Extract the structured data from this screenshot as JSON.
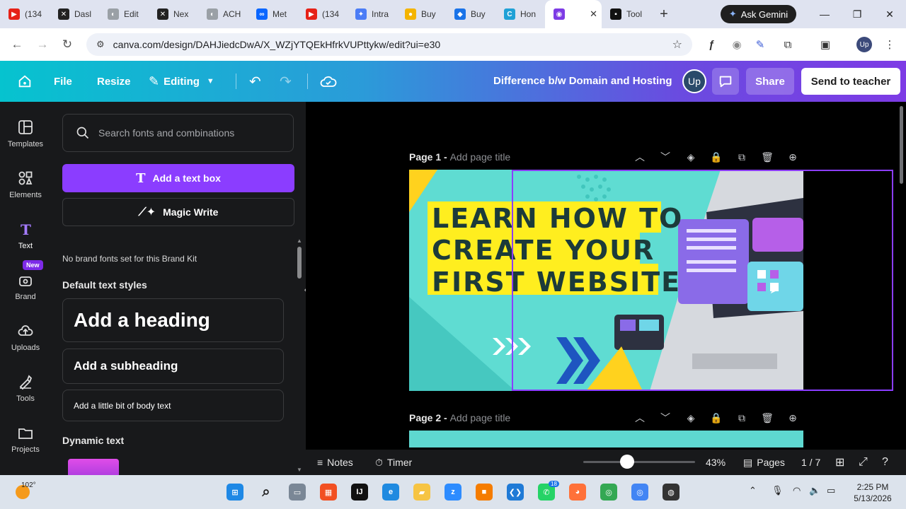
{
  "browser": {
    "tabs": [
      {
        "label": "(134",
        "icon": "youtube-icon",
        "color": "#e62117"
      },
      {
        "label": "Dasl",
        "icon": "ch-icon",
        "color": "#222222"
      },
      {
        "label": "Edit",
        "icon": "globe-icon",
        "color": "#9aa0a6"
      },
      {
        "label": "Nex",
        "icon": "ch-icon",
        "color": "#222222"
      },
      {
        "label": "ACH",
        "icon": "globe-icon",
        "color": "#9aa0a6"
      },
      {
        "label": "Met",
        "icon": "meta-icon",
        "color": "#0a66ff"
      },
      {
        "label": "(134",
        "icon": "youtube-icon",
        "color": "#e62117"
      },
      {
        "label": "Intra",
        "icon": "gemini-icon",
        "color": "#4b7cf6"
      },
      {
        "label": "Buy",
        "icon": "buy-icon",
        "color": "#f4b400"
      },
      {
        "label": "Buy",
        "icon": "shield-icon",
        "color": "#1a73e8"
      },
      {
        "label": "Hon",
        "icon": "canva-icon",
        "color": "#1fa1d6"
      },
      {
        "label": "",
        "icon": "canva-chat-icon",
        "color": "#7d3be5",
        "active": true
      },
      {
        "label": "Tool",
        "icon": "terminal-icon",
        "color": "#111111"
      }
    ],
    "ask_gemini": "Ask Gemini",
    "url": "canva.com/design/DAHJiedcDwA/X_WZjYTQEkHfrkVUPttykw/edit?ui=e30",
    "profile_initials": "Up"
  },
  "header": {
    "file": "File",
    "resize": "Resize",
    "editing": "Editing",
    "doc_title": "Difference b/w Domain and Hosting",
    "avatar": "Up",
    "share": "Share",
    "send": "Send to teacher"
  },
  "rail": {
    "items": [
      {
        "label": "Templates",
        "icon": "templates-icon"
      },
      {
        "label": "Elements",
        "icon": "elements-icon"
      },
      {
        "label": "Text",
        "icon": "text-icon"
      },
      {
        "label": "Brand",
        "icon": "brand-icon"
      },
      {
        "label": "Uploads",
        "icon": "uploads-icon"
      },
      {
        "label": "Tools",
        "icon": "tools-icon"
      },
      {
        "label": "Projects",
        "icon": "projects-icon"
      }
    ],
    "new_badge": "New"
  },
  "panel": {
    "search_placeholder": "Search fonts and combinations",
    "add_text_box": "Add a text box",
    "magic_write": "Magic Write",
    "no_brand": "No brand fonts set for this Brand Kit",
    "default_styles": "Default text styles",
    "heading": "Add a heading",
    "subheading": "Add a subheading",
    "body": "Add a little bit of body text",
    "dynamic": "Dynamic text"
  },
  "canvas": {
    "page1_label": "Page 1 - ",
    "page1_sub": "Add page title",
    "page2_label": "Page 2 - ",
    "page2_sub": "Add page title",
    "headline": [
      "LEARN HOW TO",
      "CREATE YOUR",
      "FIRST WEBSITE"
    ],
    "accent_yellow": "#ffee1f",
    "accent_blue": "#1e55c0",
    "selection_color": "#8b3dff"
  },
  "bottom": {
    "notes": "Notes",
    "timer": "Timer",
    "zoom": "43%",
    "pages": "Pages",
    "page_count": "1 / 7"
  },
  "taskbar": {
    "temperature": "102°",
    "time": "2:25 PM",
    "date": "5/13/2026",
    "whatsapp_badge": "18"
  }
}
